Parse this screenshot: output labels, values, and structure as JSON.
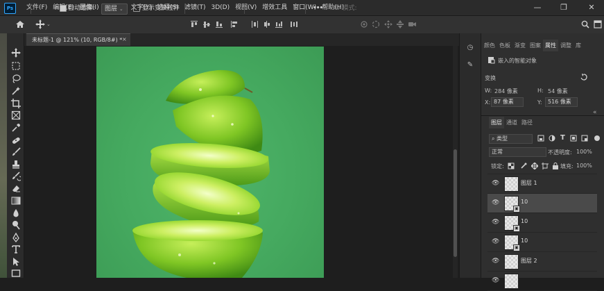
{
  "app": {
    "logo": "Ps"
  },
  "menu": [
    "文件(F)",
    "编辑(E)",
    "图像(I)",
    "图层(L)",
    "文字(Y)",
    "选择(S)",
    "滤镜(T)",
    "3D(D)",
    "视图(V)",
    "增效工具",
    "窗口(W)",
    "帮助(H)"
  ],
  "window_controls": {
    "minimize": "—",
    "restore": "❐",
    "close": "✕"
  },
  "options": {
    "auto_select_label": "自动选择:",
    "auto_select_checked": true,
    "layer_mode": "图层",
    "show_transform_label": "显示变换控件",
    "more": "•••",
    "mode_3d": "3D 模式:"
  },
  "document": {
    "tab_title": "未标题-1 @ 121% (10, RGB/8#) *",
    "close_glyph": "×"
  },
  "panels": {
    "top_tabs": [
      "颜色",
      "色板",
      "渐变",
      "图案",
      "属性",
      "调整",
      "库"
    ],
    "active_top_tab": "属性",
    "smart_object_label": "嵌入的智能对象",
    "transform_label": "变换",
    "w_label": "W:",
    "w_value": "284 像素",
    "h_label": "H:",
    "h_value": "54 像素",
    "x_label": "X:",
    "x_value": "87 像素",
    "y_label": "Y:",
    "y_value": "516 像素",
    "layer_tabs": [
      "图层",
      "通道",
      "路径"
    ],
    "active_layer_tab": "图层",
    "filter_kind": "类型",
    "blend_mode": "正常",
    "opacity_label": "不透明度:",
    "opacity_value": "100%",
    "lock_label": "锁定:",
    "fill_label": "填充:",
    "fill_value": "100%"
  },
  "layers": [
    {
      "name": "图层 1",
      "selected": false,
      "smart": false
    },
    {
      "name": "10",
      "selected": true,
      "smart": true
    },
    {
      "name": "10",
      "selected": false,
      "smart": true
    },
    {
      "name": "10",
      "selected": false,
      "smart": true
    },
    {
      "name": "图层 2",
      "selected": false,
      "smart": false
    },
    {
      "name": "",
      "selected": false,
      "smart": false
    }
  ],
  "colors": {
    "accent": "#31a8ff",
    "canvas_bg": "#45a95f",
    "lime": "#8fd42a"
  }
}
